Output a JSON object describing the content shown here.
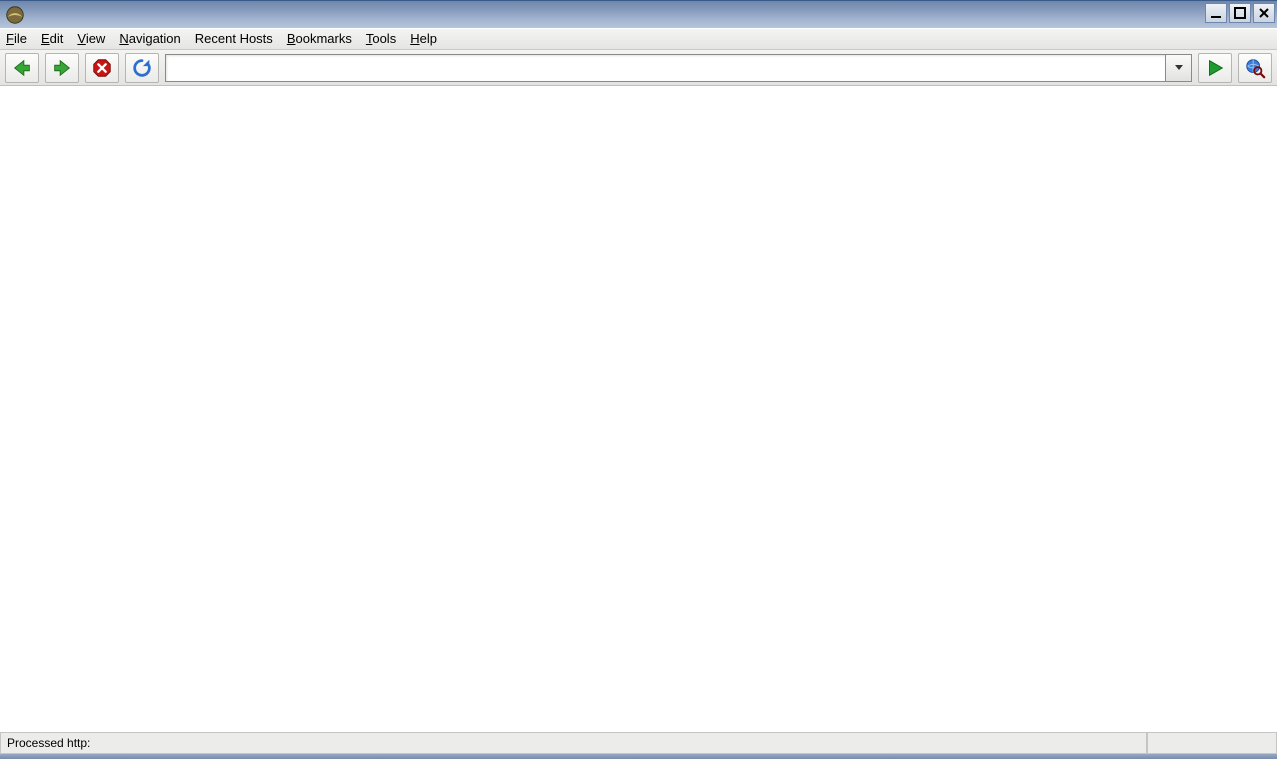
{
  "titlebar": {
    "app_icon": "konqueror-icon",
    "minimize_label": "minimize",
    "maximize_label": "maximize",
    "close_label": "close"
  },
  "menubar": {
    "items": [
      {
        "label": "File",
        "mnemonic_index": 0
      },
      {
        "label": "Edit",
        "mnemonic_index": 0
      },
      {
        "label": "View",
        "mnemonic_index": 0
      },
      {
        "label": "Navigation",
        "mnemonic_index": 0
      },
      {
        "label": "Recent Hosts",
        "mnemonic_index": -1
      },
      {
        "label": "Bookmarks",
        "mnemonic_index": 0
      },
      {
        "label": "Tools",
        "mnemonic_index": 0
      },
      {
        "label": "Help",
        "mnemonic_index": 0
      }
    ]
  },
  "toolbar": {
    "back_label": "Back",
    "forward_label": "Forward",
    "stop_label": "Stop",
    "reload_label": "Reload",
    "go_label": "Go",
    "search_label": "Search Web",
    "url_value": "",
    "url_placeholder": ""
  },
  "status": {
    "text": "Processed http:"
  },
  "colors": {
    "titlebar_grad_from": "#6f86ac",
    "titlebar_grad_to": "#b6c5da",
    "chrome_bg": "#e5e5e3"
  }
}
